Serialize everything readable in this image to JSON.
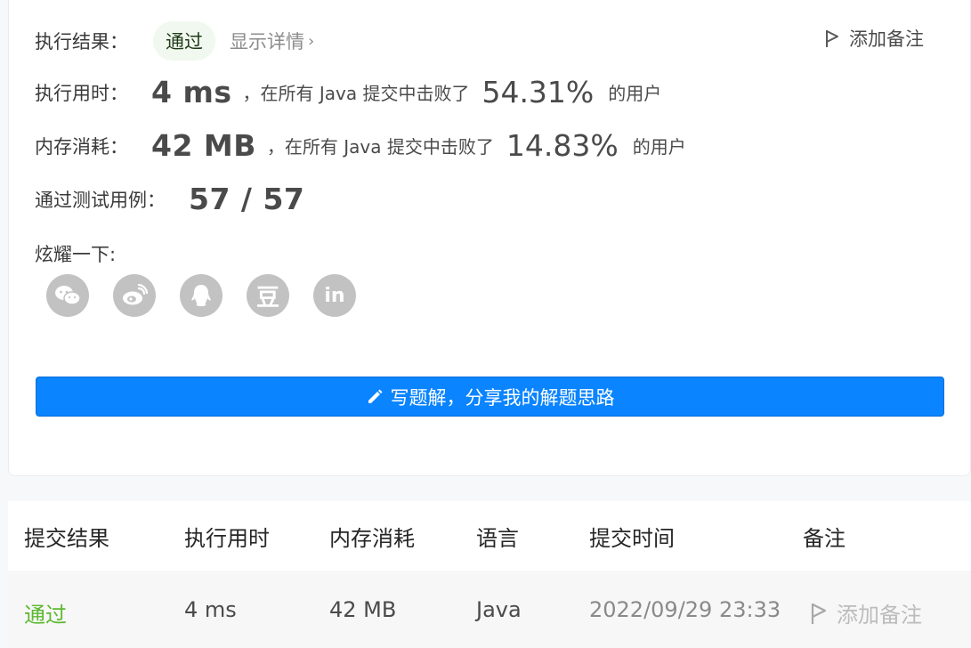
{
  "result": {
    "label": "执行结果：",
    "status": "通过",
    "details_link": "显示详情",
    "add_note": "添加备注"
  },
  "runtime": {
    "label": "执行用时：",
    "value": "4 ms",
    "desc": "，在所有 Java 提交中击败了",
    "percent": "54.31%",
    "suffix": "的用户"
  },
  "memory": {
    "label": "内存消耗：",
    "value": "42 MB",
    "desc": "，在所有 Java 提交中击败了",
    "percent": "14.83%",
    "suffix": "的用户"
  },
  "tests": {
    "label": "通过测试用例：",
    "value": "57 / 57"
  },
  "share": {
    "label": "炫耀一下:",
    "icons": [
      "wechat-icon",
      "weibo-icon",
      "qq-icon",
      "douban-icon",
      "linkedin-icon"
    ],
    "douban_glyph": "豆",
    "linkedin_glyph": "in"
  },
  "write_solution": {
    "label": "写题解，分享我的解题思路"
  },
  "table": {
    "headers": [
      "提交结果",
      "执行用时",
      "内存消耗",
      "语言",
      "提交时间",
      "备注"
    ],
    "rows": [
      {
        "result": "通过",
        "runtime": "4 ms",
        "memory": "42 MB",
        "language": "Java",
        "time": "2022/09/29 23:33",
        "note": "添加备注"
      }
    ]
  },
  "colors": {
    "accent": "#0a84ff",
    "pass_green": "#5cb82f",
    "icon_gray": "#c2c2c2"
  }
}
